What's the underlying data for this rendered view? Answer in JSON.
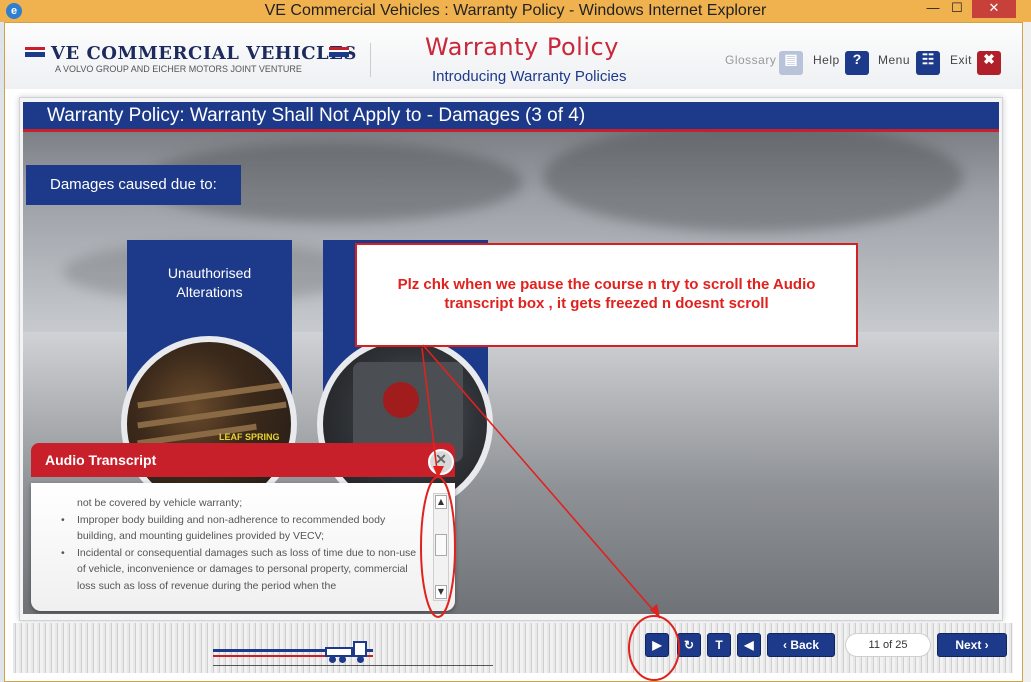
{
  "window": {
    "title": "VE Commercial Vehicles : Warranty Policy - Windows Internet Explorer",
    "minimize": "—",
    "maximize": "☐",
    "close": "✕"
  },
  "header": {
    "brand_name": "VE COMMERCIAL VEHICLES",
    "brand_tagline": "A VOLVO GROUP AND EICHER MOTORS JOINT VENTURE",
    "course_title": "Warranty Policy",
    "course_subtitle": "Introducing Warranty Policies",
    "nav": {
      "glossary": "Glossary",
      "help": "Help",
      "menu": "Menu",
      "exit": "Exit"
    }
  },
  "slide": {
    "title": "Warranty Policy: Warranty Shall Not Apply to - Damages (3 of 4)",
    "intro": "Damages caused due to:",
    "cards": [
      {
        "label_line1": "Unauthorised",
        "label_line2": "Alterations",
        "photo_caption": "LEAF SPRING"
      },
      {
        "label_line1": "Imp",
        "label_line2": "an"
      }
    ]
  },
  "annotation_note": {
    "line1": "Plz chk when we pause the course n try to scroll the Audio",
    "line2": "transcript box , it gets freezed n doesnt scroll"
  },
  "transcript": {
    "heading": "Audio Transcript",
    "close_glyph": "✕",
    "lines": [
      {
        "bullet": false,
        "text": "not be covered by vehicle warranty;"
      },
      {
        "bullet": true,
        "text": "Improper body building and non-adherence to recommended body building, and mounting guidelines provided by VECV;"
      },
      {
        "bullet": true,
        "text": "Incidental or consequential damages such as loss of time due to non-use of vehicle, inconvenience or damages to personal property, commercial loss such as loss of revenue during the period when the"
      }
    ]
  },
  "footer": {
    "back_label": "Back",
    "next_label": "Next",
    "page_indicator": "11 of 25"
  },
  "colors": {
    "brand_blue": "#1d3a8a",
    "brand_red": "#c8202a",
    "annotation_red": "#e0221e",
    "titlebar": "#f0b24e"
  },
  "icons": [
    "ie-icon",
    "glossary-icon",
    "help-icon",
    "menu-icon",
    "exit-icon",
    "play-icon",
    "replay-icon",
    "text-icon",
    "audio-icon",
    "chevron-left-icon",
    "chevron-right-icon",
    "close-icon",
    "truck-icon"
  ]
}
